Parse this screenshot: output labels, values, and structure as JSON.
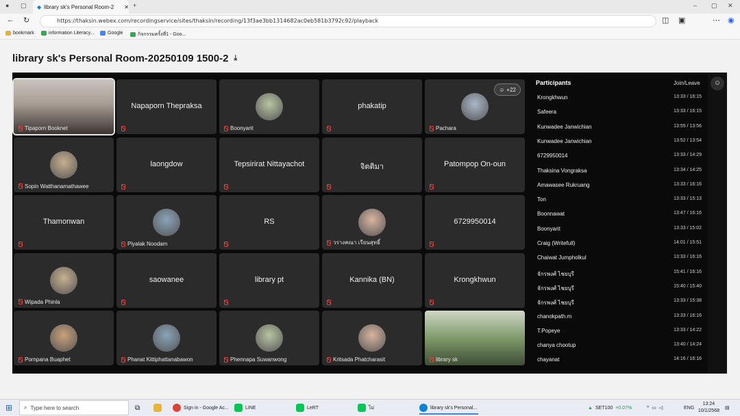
{
  "browser": {
    "tab_title": "library sk's Personal Room-2",
    "url": "https://thaksin.webex.com/recordingservice/sites/thaksin/recording/13f3ae3bb1314682ac0eb581b3792c92/playback",
    "bookmarks": [
      "bookmark",
      "information Literacy...",
      "Google",
      "กิจกรรมครั้งที่1 - Goo..."
    ]
  },
  "page": {
    "title": "library sk's Personal Room-20250109 1500-2"
  },
  "tiles": [
    {
      "name": "Tipaporn Booknet",
      "big": "",
      "type": "video"
    },
    {
      "name": "",
      "big": "Napaporn Thepraksa",
      "type": "text"
    },
    {
      "name": "Boonyarit",
      "big": "",
      "type": "avatar"
    },
    {
      "name": "",
      "big": "phakatip",
      "type": "text"
    },
    {
      "name": "Pachara",
      "big": "",
      "type": "avatar"
    },
    {
      "name": "Sopin Watthanamathawee",
      "big": "",
      "type": "avatar"
    },
    {
      "name": "",
      "big": "laongdow",
      "type": "text"
    },
    {
      "name": "",
      "big": "Tepsirirat Nittayachot",
      "type": "text"
    },
    {
      "name": "",
      "big": "จิตติมา",
      "type": "text"
    },
    {
      "name": "",
      "big": "Patompop On-oun",
      "type": "text"
    },
    {
      "name": "",
      "big": "Thamonwan",
      "type": "text"
    },
    {
      "name": "Piyalak Noodam",
      "big": "",
      "type": "avatar"
    },
    {
      "name": "",
      "big": "RS",
      "type": "text"
    },
    {
      "name": "วรางคณา เรียนสุทธิ์",
      "big": "",
      "type": "avatar"
    },
    {
      "name": "",
      "big": "6729950014",
      "type": "text"
    },
    {
      "name": "Wipada Phinla",
      "big": "",
      "type": "avatar"
    },
    {
      "name": "",
      "big": "saowanee",
      "type": "text"
    },
    {
      "name": "",
      "big": "library pt",
      "type": "text"
    },
    {
      "name": "",
      "big": "Kannika (BN)",
      "type": "text"
    },
    {
      "name": "",
      "big": "Krongkhwun",
      "type": "text"
    },
    {
      "name": "Pornpana Buaphet",
      "big": "",
      "type": "avatar"
    },
    {
      "name": "Phanat Kittiphattanabawon",
      "big": "",
      "type": "avatar"
    },
    {
      "name": "Phennapa Suwanwong",
      "big": "",
      "type": "avatar"
    },
    {
      "name": "Kritsada Phatcharasit",
      "big": "",
      "type": "avatar"
    },
    {
      "name": "library sk",
      "big": "",
      "type": "video2"
    }
  ],
  "overflow_badge": "+22",
  "participants_panel": {
    "title": "Participants",
    "join_leave_header": "Join/Leave",
    "rows": [
      {
        "name": "Krongkhwun",
        "time": "13:33 / 16:15"
      },
      {
        "name": "Safeera",
        "time": "13:33 / 16:15"
      },
      {
        "name": "Kunwadee Janwichian",
        "time": "13:55 / 13:56"
      },
      {
        "name": "Kunwadee Janwichian",
        "time": "13:52 / 13:54"
      },
      {
        "name": "6729950014",
        "time": "13:33 / 14:29"
      },
      {
        "name": "Thaksina Vongraksa",
        "time": "13:34 / 14:25"
      },
      {
        "name": "Amawasee Rukruang",
        "time": "13:33 / 16:16"
      },
      {
        "name": "Ton",
        "time": "13:33 / 15:13"
      },
      {
        "name": "Boonnawat",
        "time": "13:47 / 16:16"
      },
      {
        "name": "Boonyarit",
        "time": "13:33 / 15:02"
      },
      {
        "name": "Craig (Writefull)",
        "time": "14:01 / 15:51"
      },
      {
        "name": "Chaiwat Jumpholkul",
        "time": "13:33 / 16:16"
      },
      {
        "name": "จักรพงศ์ ไชยบุรี",
        "time": "15:41 / 16:16"
      },
      {
        "name": "จักรพงศ์ ไชยบุรี",
        "time": "15:40 / 15:40"
      },
      {
        "name": "จักรพงศ์ ไชยบุรี",
        "time": "13:33 / 15:38"
      },
      {
        "name": "chanokpath.m",
        "time": "13:33 / 16:16"
      },
      {
        "name": "T.Popeye",
        "time": "13:33 / 14:22"
      },
      {
        "name": "chanya chootup",
        "time": "13:40 / 14:24"
      },
      {
        "name": "chayanat",
        "time": "14:16 / 16:16"
      }
    ]
  },
  "taskbar": {
    "search_placeholder": "Type here to search",
    "apps": [
      "Sign in - Google Ac...",
      "LINE",
      "LeRT",
      "ไม่",
      "library sk's Personal..."
    ],
    "ticker": "SET100",
    "ticker_change": "+0.07%",
    "lang": "ENG",
    "time": "13:24",
    "date": "10/1/2568"
  }
}
